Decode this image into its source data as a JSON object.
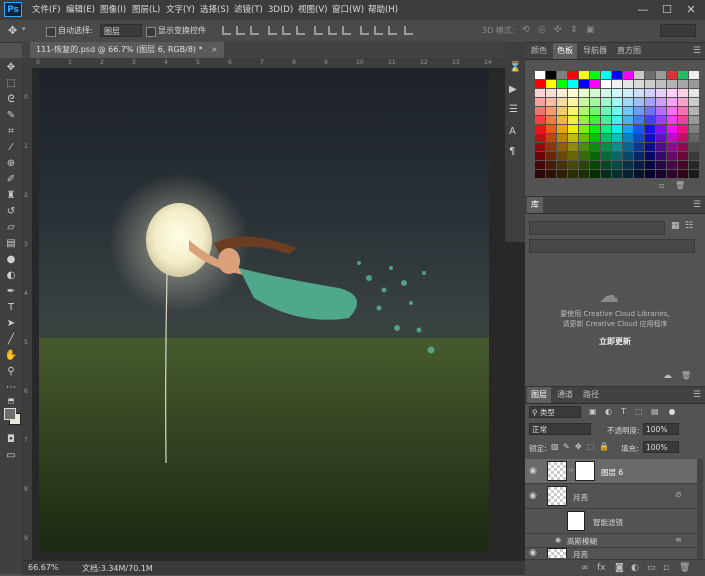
{
  "menubar": {
    "logo": "Ps",
    "items": [
      "文件(F)",
      "编辑(E)",
      "图像(I)",
      "图层(L)",
      "文字(Y)",
      "选择(S)",
      "滤镜(T)",
      "3D(D)",
      "视图(V)",
      "窗口(W)",
      "帮助(H)"
    ],
    "window_buttons": [
      "—",
      "☐",
      "✕"
    ]
  },
  "options": {
    "auto_select_label": "自动选择:",
    "auto_select_value": "图层",
    "show_transform_label": "显示变换控件",
    "mode_3d_label": "3D 模式:"
  },
  "document": {
    "tab_title": "111-恢复的.psd @ 66.7% (图层 6, RGB/8) *",
    "tab_close": "×",
    "ruler_top_labels": [
      "0",
      "1",
      "2",
      "3",
      "4",
      "5",
      "6",
      "7",
      "8",
      "9",
      "10",
      "11",
      "12",
      "13",
      "14"
    ],
    "ruler_left_labels": [
      "0",
      "1",
      "2",
      "3",
      "4",
      "5",
      "6",
      "7",
      "8",
      "9"
    ]
  },
  "status": {
    "zoom": "66.67%",
    "doc_info": "文档:3.34M/70.1M"
  },
  "color_panel": {
    "tabs": [
      "颜色",
      "色板",
      "导航器",
      "直方图"
    ],
    "active_tab": "色板"
  },
  "libraries_panel": {
    "title": "库",
    "message_line1": "要使用 Creative Cloud Libraries,",
    "message_line2": "请更新 Creative Cloud 应用程序",
    "update_link": "立即更新"
  },
  "layers_panel": {
    "tabs": [
      "图层",
      "通道",
      "路径"
    ],
    "active_tab": "图层",
    "filter_kind": "类型",
    "blend_mode": "正常",
    "opacity_label": "不透明度:",
    "opacity_value": "100%",
    "lock_label": "锁定:",
    "fill_label": "填充:",
    "fill_value": "100%",
    "layers": [
      {
        "name": "图层 6",
        "selected": true
      },
      {
        "name": "月亮",
        "selected": false
      },
      {
        "name": "智能滤镜",
        "selected": false
      },
      {
        "name": "高斯模糊",
        "selected": false
      },
      {
        "name": "月亮",
        "selected": false
      }
    ]
  },
  "colors": {
    "accent": "#31a8ff",
    "panel_bg": "#535353",
    "menubar_bg": "#3c3c3c",
    "selected_layer": "#6a6a6a"
  }
}
